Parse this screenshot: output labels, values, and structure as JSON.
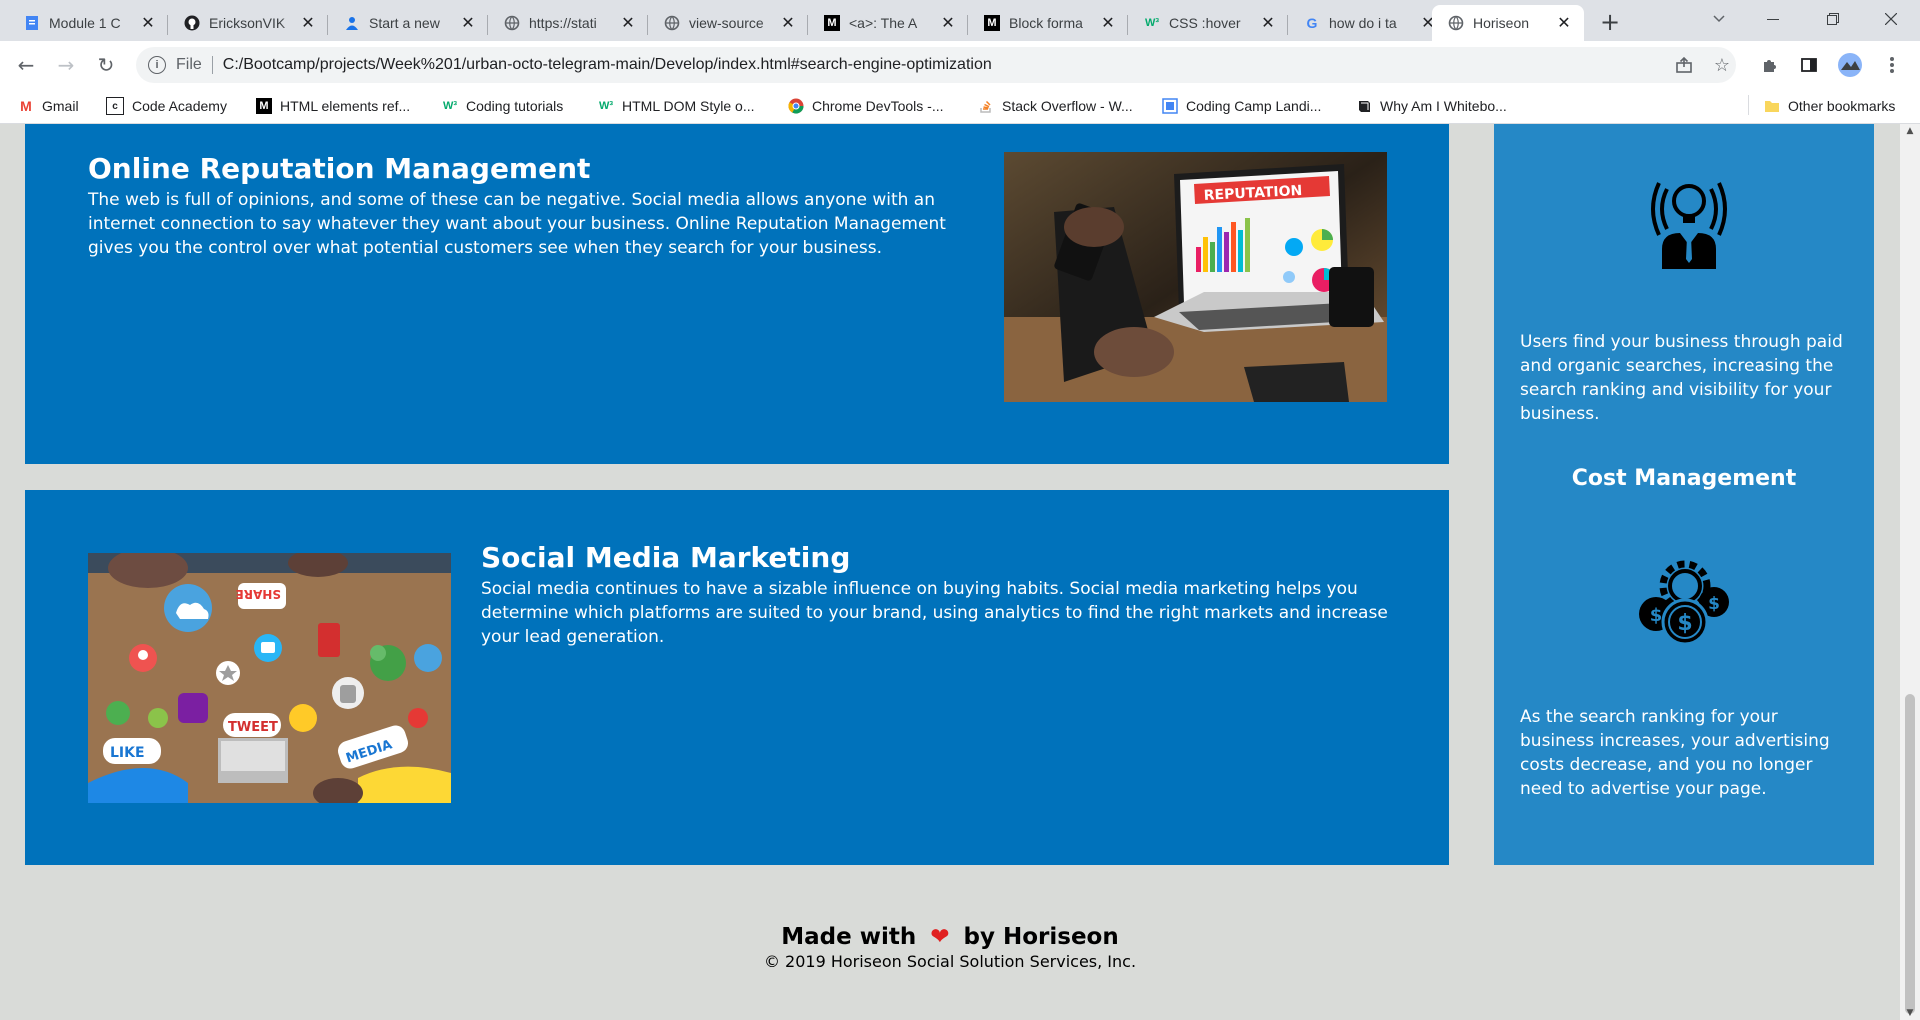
{
  "browser": {
    "tabs": [
      {
        "title": "Module 1 C",
        "icon": "doc-icon"
      },
      {
        "title": "EricksonVIK",
        "icon": "github-icon"
      },
      {
        "title": "Start a new",
        "icon": "person-icon"
      },
      {
        "title": "https://stati",
        "icon": "globe-icon"
      },
      {
        "title": "view-source",
        "icon": "globe-icon"
      },
      {
        "title": "<a>: The A",
        "icon": "mdn-icon"
      },
      {
        "title": "Block forma",
        "icon": "mdn-icon"
      },
      {
        "title": "CSS :hover",
        "icon": "w3-icon"
      },
      {
        "title": "how do i ta",
        "icon": "google-icon"
      },
      {
        "title": "Horiseon",
        "icon": "globe-icon",
        "active": true
      }
    ],
    "new_tab": "+",
    "address": {
      "scheme_label": "File",
      "url": "C:/Bootcamp/projects/Week%201/urban-octo-telegram-main/Develop/index.html#search-engine-optimization"
    },
    "bookmarks": [
      {
        "label": "Gmail"
      },
      {
        "label": "Code Academy"
      },
      {
        "label": "HTML elements ref..."
      },
      {
        "label": "Coding tutorials"
      },
      {
        "label": "HTML DOM Style o..."
      },
      {
        "label": "Chrome DevTools -..."
      },
      {
        "label": "Stack Overflow - W..."
      },
      {
        "label": "Coding Camp Landi..."
      },
      {
        "label": "Why Am I Whitebo..."
      }
    ],
    "other_bookmarks": "Other bookmarks"
  },
  "content": {
    "reputation": {
      "title": "Online Reputation Management",
      "text": "The web is full of opinions, and some of these can be negative. Social media allows anyone with an internet connection to say whatever they want about your business. Online Reputation Management gives you the control over what potential customers see when they search for your business.",
      "image_label": "REPUTATION"
    },
    "social": {
      "title": "Social Media Marketing",
      "text": "Social media continues to have a sizable influence on buying habits. Social media marketing helps you determine which platforms are suited to your brand, using analytics to find the right markets and increase your lead generation.",
      "image_words": [
        "SHARE",
        "TWEET",
        "LIKE",
        "MEDIA"
      ]
    }
  },
  "aside": {
    "lead_text": "Users find your business through paid and organic searches, increasing the search ranking and visibility for your business.",
    "cost_title": "Cost Management",
    "cost_text": "As the search ranking for your business increases, your advertising costs decrease, and you no longer need to advertise your page."
  },
  "footer": {
    "made_with": "Made with",
    "by": "by Horiseon",
    "copyright": "© 2019 Horiseon Social Solution Services, Inc."
  },
  "colors": {
    "card_blue": "#0072bb",
    "aside_blue": "#2588c6",
    "page_bg": "#d9dbd8",
    "heart": "#e02020"
  }
}
